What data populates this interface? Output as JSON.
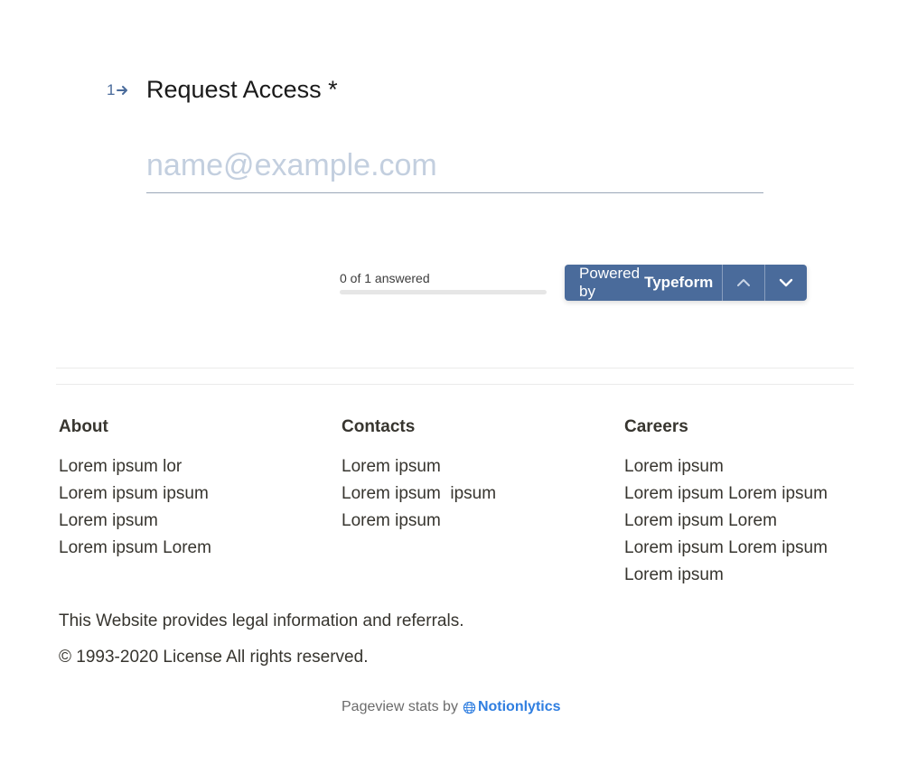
{
  "question": {
    "number": "1",
    "title": "Request Access *",
    "input_placeholder": "name@example.com",
    "input_value": ""
  },
  "progress": {
    "label": "0 of 1 answered",
    "answered": 0,
    "total": 1,
    "fraction": 0
  },
  "typeform_bar": {
    "powered_by": "Powered by",
    "brand": "Typeform",
    "prev_icon": "chevron-up-icon",
    "next_icon": "chevron-down-icon",
    "accent": "#4a6b9b"
  },
  "footer": {
    "columns": [
      {
        "heading": "About",
        "items": [
          "Lorem ipsum lor",
          "Lorem ipsum ipsum",
          "Lorem ipsum",
          "Lorem ipsum Lorem"
        ]
      },
      {
        "heading": "Contacts",
        "items": [
          "Lorem ipsum",
          "Lorem ipsum  ipsum",
          "Lorem ipsum"
        ]
      },
      {
        "heading": "Careers",
        "items": [
          "Lorem ipsum",
          "Lorem ipsum Lorem ipsum",
          "Lorem ipsum Lorem",
          "Lorem ipsum Lorem ipsum",
          "Lorem ipsum"
        ]
      }
    ],
    "legal_text": "This Website provides legal information and referrals.",
    "copyright": "© 1993-2020 License All rights reserved.",
    "stats_prefix": "Pageview stats by",
    "stats_brand": "Notionlytics",
    "stats_icon": "globe-icon",
    "stats_brand_color": "#2f7ee0"
  }
}
